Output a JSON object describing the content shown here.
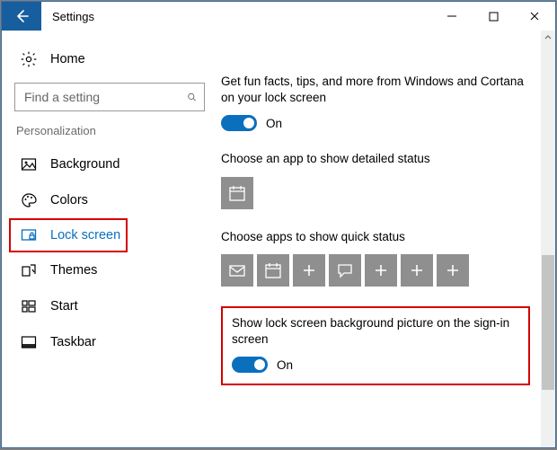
{
  "titlebar": {
    "title": "Settings"
  },
  "sidebar": {
    "home_label": "Home",
    "search_placeholder": "Find a setting",
    "category_label": "Personalization",
    "items": [
      {
        "label": "Background"
      },
      {
        "label": "Colors"
      },
      {
        "label": "Lock screen"
      },
      {
        "label": "Themes"
      },
      {
        "label": "Start"
      },
      {
        "label": "Taskbar"
      }
    ]
  },
  "main": {
    "fun_facts": {
      "title": "Get fun facts, tips, and more from Windows and Cortana on your lock screen",
      "state_label": "On"
    },
    "detailed_status": {
      "title": "Choose an app to show detailed status"
    },
    "quick_status": {
      "title": "Choose apps to show quick status"
    },
    "signin_bg": {
      "title": "Show lock screen background picture on the sign-in screen",
      "state_label": "On"
    }
  }
}
